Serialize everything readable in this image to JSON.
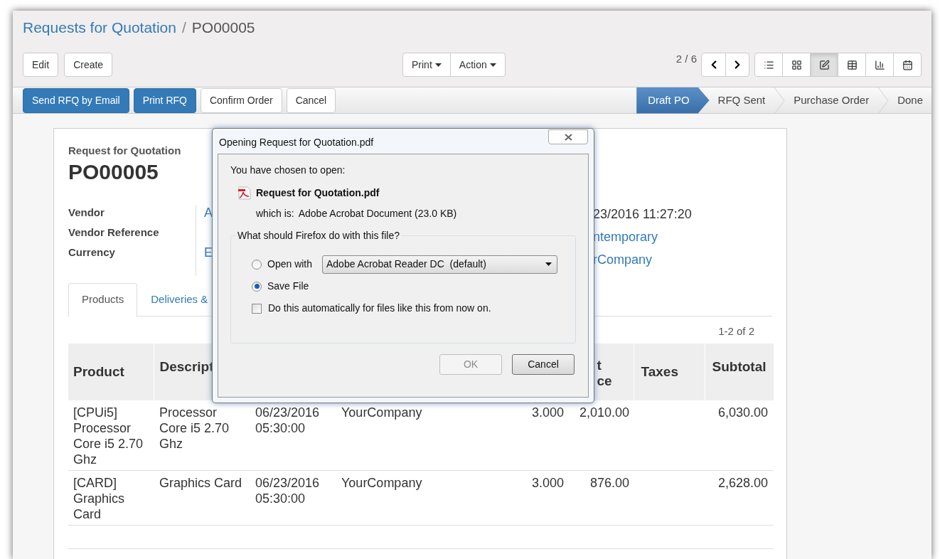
{
  "breadcrumb": {
    "parent": "Requests for Quotation",
    "separator": "/",
    "current": "PO00005"
  },
  "toolbar": {
    "left_buttons": [
      "Edit",
      "Create"
    ],
    "dropdowns": [
      "Print",
      "Action"
    ],
    "pager": "2 / 6",
    "views": [
      {
        "kind": "list",
        "selected": false
      },
      {
        "kind": "kanban",
        "selected": false
      },
      {
        "kind": "form",
        "selected": true
      },
      {
        "kind": "pivot",
        "selected": false
      },
      {
        "kind": "graph",
        "selected": false
      },
      {
        "kind": "calendar",
        "selected": false
      }
    ]
  },
  "status_bar": {
    "buttons": [
      {
        "label": "Send RFQ by Email",
        "primary": true
      },
      {
        "label": "Print RFQ",
        "primary": true
      },
      {
        "label": "Confirm Order",
        "primary": false
      },
      {
        "label": "Cancel",
        "primary": false
      }
    ],
    "stages": [
      {
        "label": "Draft PO",
        "selected": true
      },
      {
        "label": "RFQ Sent",
        "selected": false
      },
      {
        "label": "Purchase Order",
        "selected": false
      },
      {
        "label": "Done",
        "selected": false
      }
    ]
  },
  "sheet": {
    "subtitle": "Request for Quotation",
    "title": "PO00005",
    "fields": [
      {
        "label": "Vendor",
        "value": "A"
      },
      {
        "label": "Vendor Reference"
      },
      {
        "label": "Currency",
        "value": "E"
      }
    ],
    "right_values": [
      {
        "text": "23/2016 11:27:20",
        "link": false
      },
      {
        "text": "ntemporary",
        "link": true
      },
      {
        "text": "rCompany",
        "link": true
      }
    ],
    "tabs": [
      {
        "label": "Products",
        "selected": true
      },
      {
        "label": "Deliveries &",
        "selected": false
      }
    ],
    "pager": "1-2 of 2",
    "table": {
      "header": {
        "product": "Product",
        "description": "Descript",
        "unit_price": [
          "t",
          "ce"
        ],
        "taxes": "Taxes",
        "subtotal": "Subtotal"
      },
      "rows": [
        {
          "product": "[CPUi5] Processor Core i5 2.70 Ghz",
          "description": "Processor Core i5 2.70 Ghz",
          "date": "06/23/2016 05:30:00",
          "column_4": "YourCompany",
          "quantity": "3.000",
          "unit_price": "2,010.00",
          "subtotal": "6,030.00"
        },
        {
          "product": "[CARD] Graphics Card",
          "description": "Graphics Card",
          "date": "06/23/2016 05:30:00",
          "column_4": "YourCompany",
          "quantity": "3.000",
          "unit_price": "876.00",
          "subtotal": "2,628.00"
        }
      ]
    }
  },
  "dialog": {
    "title": "Opening Request for Quotation.pdf",
    "intro": "You have chosen to open:",
    "file_name": "Request for Quotation.pdf",
    "type_label": "which is:",
    "type_value": "Adobe Acrobat Document (23.0 KB)",
    "question": "What should Firefox do with this file?",
    "options": [
      {
        "label": "Open with",
        "selected": false
      },
      {
        "label": "Save File",
        "selected": true
      }
    ],
    "application": "Adobe Acrobat Reader DC  (default)",
    "auto": {
      "label": "Do this automatically for files like this from now on.",
      "checked": false
    },
    "buttons": [
      {
        "label": "OK",
        "disabled": true
      },
      {
        "label": "Cancel",
        "disabled": false
      }
    ]
  }
}
